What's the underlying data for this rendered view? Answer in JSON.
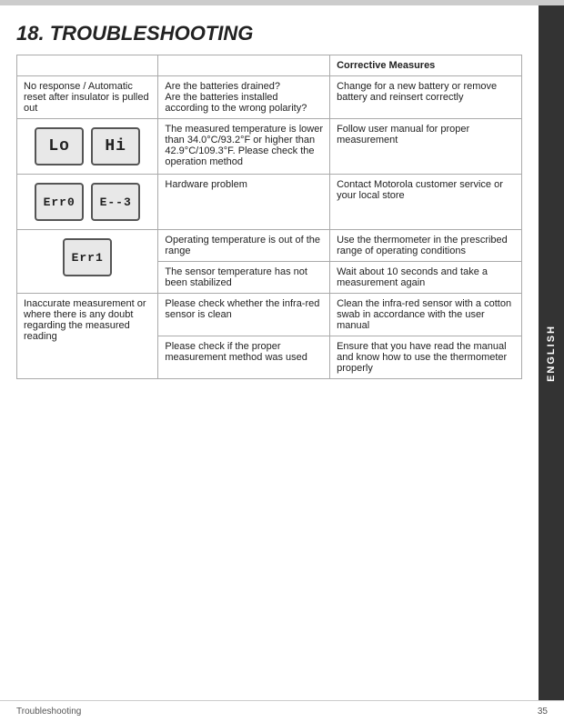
{
  "header": {
    "title": "18.  TROUBLESHOOTING",
    "top_border_color": "#cccccc"
  },
  "side_tab": {
    "label": "ENGLISH"
  },
  "table": {
    "headers": [
      "",
      "",
      "Corrective Measures"
    ],
    "rows": [
      {
        "col1": "No response / Automatic reset after insulator is pulled out",
        "col1_type": "text",
        "col2": "Are the batteries drained?\nAre the batteries installed according to the wrong polarity?",
        "col3": "Change for a new battery or remove battery and reinsert correctly"
      },
      {
        "col1": "",
        "col1_type": "image_lo_hi",
        "col2": "The measured temperature is lower than 34.0°C/93.2°F or higher than 42.9°C/109.3°F. Please check the operation method",
        "col3": "Follow user manual for proper measurement"
      },
      {
        "col1": "",
        "col1_type": "image_err",
        "col2": "Hardware problem",
        "col3": "Contact Motorola customer service or your local store"
      },
      {
        "col1": "",
        "col1_type": "image_err1",
        "col2": "Operating temperature is out of the range",
        "col3": "Use the thermometer in the prescribed range of operating conditions",
        "row_span": true
      },
      {
        "col1": null,
        "col1_type": "none",
        "col2": "The sensor temperature has not been stabilized",
        "col3": "Wait about 10 seconds and take a measurement again"
      },
      {
        "col1": "Inaccurate measurement or where there is any doubt regarding the measured reading",
        "col1_type": "text",
        "col2": "Please check whether the infra-red sensor is clean",
        "col3": "Clean the infra-red sensor with a cotton swab in accordance with the user manual"
      },
      {
        "col1": null,
        "col1_type": "none",
        "col2": "Please check if the proper measurement method was used",
        "col3": "Ensure that you have read the manual and know how to use the thermometer properly"
      }
    ]
  },
  "footer": {
    "left": "Troubleshooting",
    "right": "35"
  }
}
